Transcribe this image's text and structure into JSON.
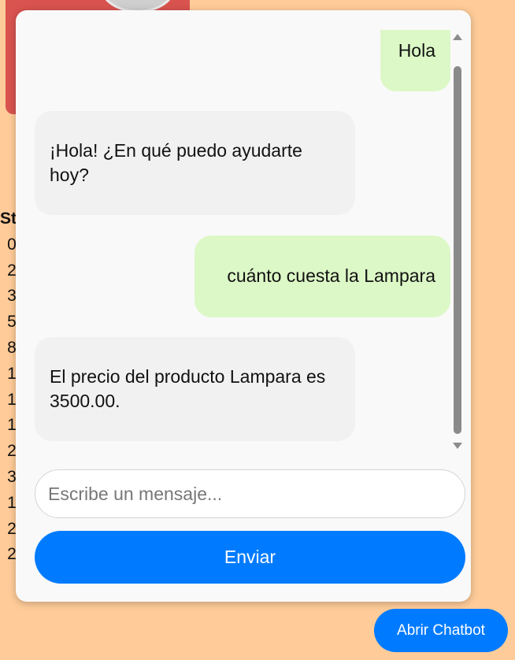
{
  "background": {
    "stock_header": "St",
    "stock_cells": [
      "0",
      "2",
      "3",
      "5",
      "8",
      "1",
      "1",
      "1",
      "2",
      "3",
      "1",
      "2",
      "2"
    ]
  },
  "chat": {
    "messages": [
      {
        "sender": "user",
        "text": "Hola"
      },
      {
        "sender": "bot",
        "text": "¡Hola! ¿En qué puedo ayudarte hoy?"
      },
      {
        "sender": "user",
        "text": "cuánto cuesta la Lampara"
      },
      {
        "sender": "bot",
        "text": "El precio del producto Lampara es 3500.00."
      }
    ],
    "input_placeholder": "Escribe un mensaje...",
    "input_value": "",
    "send_label": "Enviar"
  },
  "open_chatbot_label": "Abrir Chatbot",
  "colors": {
    "page_background": "#ffcc99",
    "user_bubble": "#dcf8c6",
    "bot_bubble": "#f1f1f1",
    "accent": "#007bff"
  },
  "icons": {
    "scroll_up": "triangle-up-icon",
    "scroll_down": "triangle-down-icon"
  }
}
